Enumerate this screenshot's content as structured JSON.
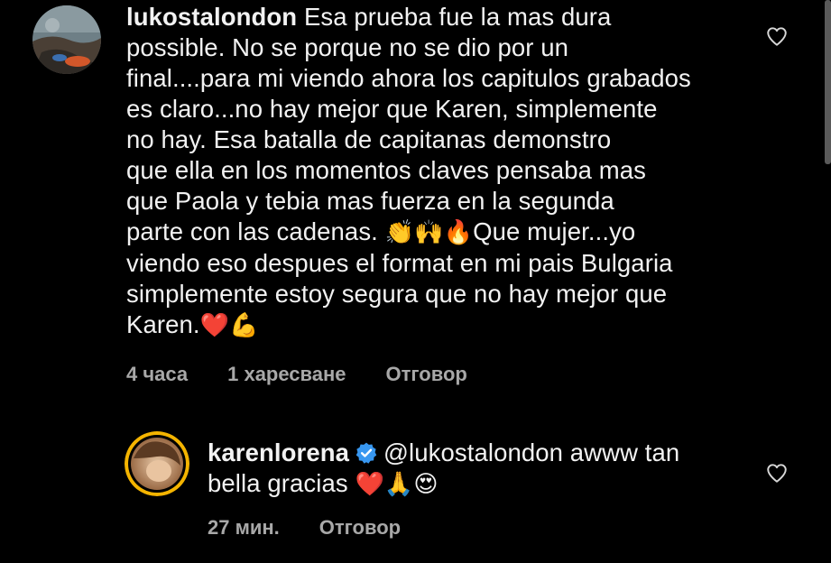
{
  "comment": {
    "username": "lukostalondon",
    "text_part1": "Esa prueba fue la mas dura\npossible. No se porque no se dio por un\nfinal....para mi viendo ahora los capitulos grabados\nes claro...no hay mejor que Karen, simplemente\nno hay.  Esa batalla de capitanas demonstro\nque ella en los momentos claves pensaba mas\nque Paola y tebia mas fuerza en la segunda\nparte con las cadenas. ",
    "emojis1": "👏🙌🔥",
    "text_part2": "Que mujer...yo\nviendo eso despues el format en mi pais Bulgaria\nsimplemente estoy segura que no hay mejor que\nKaren.",
    "emojis2": "❤️💪",
    "time": "4 часа",
    "likes": "1 харесване",
    "reply_label": "Отговор",
    "like_icon": "heart-outline-icon"
  },
  "reply": {
    "username": "karenlorena",
    "verified_icon": "verified-badge-icon",
    "mention": "@lukostalondon",
    "text_a": " awww tan",
    "text_b": "bella gracias ",
    "emojis": "❤️🙏😍",
    "time": "27 мин.",
    "reply_label": "Отговор",
    "like_icon": "heart-outline-icon"
  },
  "colors": {
    "background": "#000000",
    "text": "#f2f2f2",
    "meta": "#a8a8a8",
    "verified": "#3897f0"
  }
}
